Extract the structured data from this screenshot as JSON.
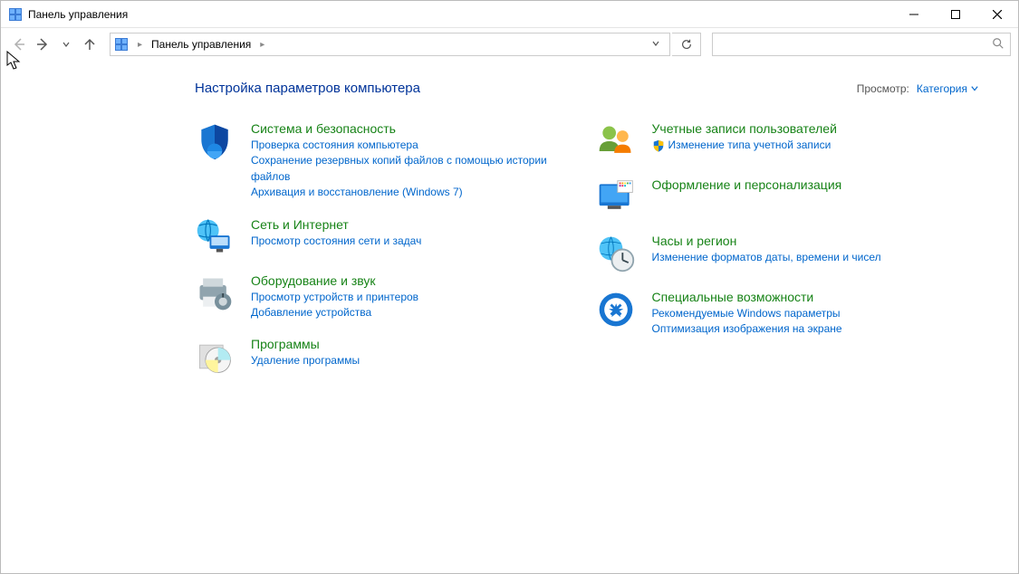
{
  "window": {
    "title": "Панель управления"
  },
  "breadcrumb": {
    "root": "Панель управления"
  },
  "header": {
    "page_title": "Настройка параметров компьютера",
    "view_label": "Просмотр:",
    "view_value": "Категория"
  },
  "left_col": [
    {
      "id": "system-security",
      "title": "Система и безопасность",
      "links": [
        "Проверка состояния компьютера",
        "Сохранение резервных копий файлов с помощью истории файлов",
        "Архивация и восстановление (Windows 7)"
      ]
    },
    {
      "id": "network",
      "title": "Сеть и Интернет",
      "links": [
        "Просмотр состояния сети и задач"
      ]
    },
    {
      "id": "hardware",
      "title": "Оборудование и звук",
      "links": [
        "Просмотр устройств и принтеров",
        "Добавление устройства"
      ]
    },
    {
      "id": "programs",
      "title": "Программы",
      "links": [
        "Удаление программы"
      ]
    }
  ],
  "right_col": [
    {
      "id": "user-accounts",
      "title": "Учетные записи пользователей",
      "links": [
        {
          "text": "Изменение типа учетной записи",
          "shield": true
        }
      ]
    },
    {
      "id": "appearance",
      "title": "Оформление и персонализация",
      "links": []
    },
    {
      "id": "clock-region",
      "title": "Часы и регион",
      "links": [
        "Изменение форматов даты, времени и чисел"
      ]
    },
    {
      "id": "ease-of-access",
      "title": "Специальные возможности",
      "links": [
        "Рекомендуемые Windows параметры",
        "Оптимизация изображения на экране"
      ]
    }
  ]
}
